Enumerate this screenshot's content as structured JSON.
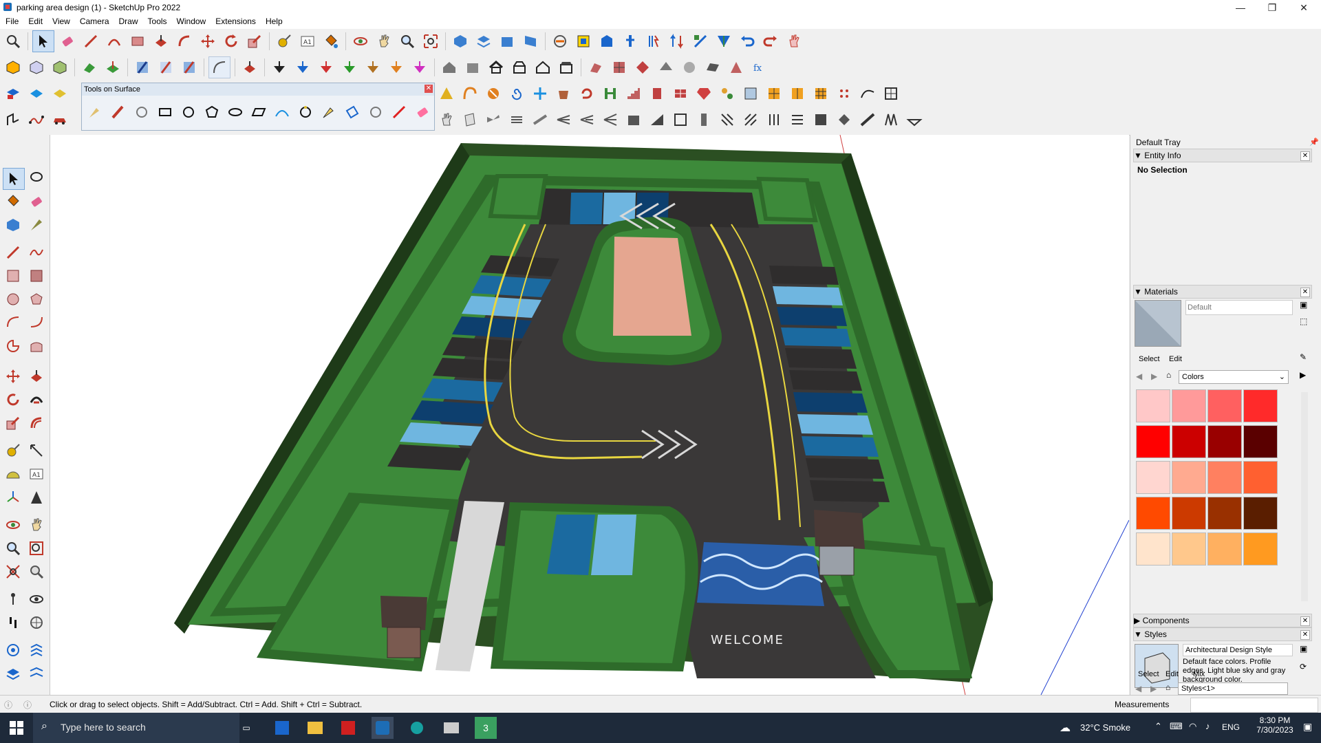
{
  "window": {
    "title": "parking area design (1) - SketchUp Pro 2022",
    "minimize": "—",
    "maximize": "❐",
    "close": "✕"
  },
  "menu": [
    "File",
    "Edit",
    "View",
    "Camera",
    "Draw",
    "Tools",
    "Window",
    "Extensions",
    "Help"
  ],
  "tools_on_surface": {
    "title": "Tools on Surface"
  },
  "tray": {
    "title": "Default Tray",
    "entity_info": {
      "header": "Entity Info",
      "selection": "No Selection"
    },
    "materials": {
      "header": "Materials",
      "name_placeholder": "Default",
      "tab_select": "Select",
      "tab_edit": "Edit",
      "library": "Colors",
      "swatches": [
        "#ffc8c8",
        "#ff9a9a",
        "#ff6060",
        "#ff2a2a",
        "#ff0000",
        "#cc0000",
        "#990000",
        "#5a0000",
        "#ffd6d0",
        "#ffaa90",
        "#ff8060",
        "#ff6030",
        "#ff4a00",
        "#cc3a00",
        "#993000",
        "#5a1e00",
        "#ffe4cc",
        "#ffc88c",
        "#ffb060",
        "#ff9a20"
      ]
    },
    "components": {
      "header": "Components"
    },
    "styles": {
      "header": "Styles",
      "style_name": "Architectural Design Style",
      "description": "Default face colors. Profile edges. Light blue sky and gray background color.",
      "tab_select": "Select",
      "tab_edit": "Edit",
      "tab_mix": "Mix",
      "library": "Styles<1>"
    }
  },
  "viewport": {
    "welcome_text": "WELCOME"
  },
  "status": {
    "hint": "Click or drag to select objects. Shift = Add/Subtract. Ctrl = Add. Shift + Ctrl = Subtract.",
    "measurements_label": "Measurements"
  },
  "taskbar": {
    "search_placeholder": "Type here to search",
    "weather": "32°C  Smoke",
    "language": "ENG",
    "time": "8:30 PM",
    "date": "7/30/2023"
  },
  "colors": {
    "accent": "#0078d7",
    "asphalt": "#3a3838",
    "grass": "#3d8a3a",
    "hedge": "#2e6b2a"
  }
}
